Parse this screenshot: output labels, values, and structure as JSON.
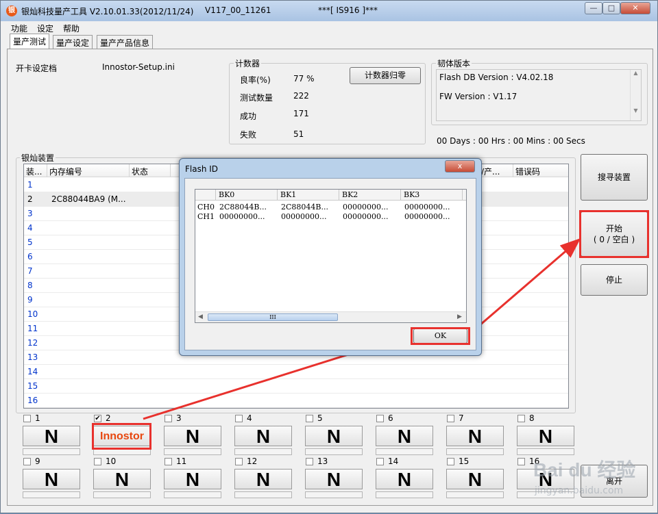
{
  "window": {
    "title": "银灿科技量产工具 V2.10.01.33(2012/11/24)",
    "version": "V117_00_11261",
    "ic": "***[ IS916 ]***",
    "icon": "银"
  },
  "menu": [
    "功能",
    "设定",
    "帮助"
  ],
  "tabs": [
    "量产测试",
    "量产设定",
    "量产产品信息"
  ],
  "config": {
    "label": "开卡设定档",
    "value": "Innostor-Setup.ini"
  },
  "counter": {
    "title": "计数器",
    "reset": "计数器归零",
    "rows": [
      {
        "label": "良率(%)",
        "value": "77 %"
      },
      {
        "label": "测试数量",
        "value": "222"
      },
      {
        "label": "成功",
        "value": "171"
      },
      {
        "label": "失败",
        "value": "51"
      }
    ]
  },
  "firmware": {
    "title": "韧体版本",
    "flash_db": "Flash DB Version :  V4.02.18",
    "fw": "FW Version :    V1.17"
  },
  "timer": "00 Days : 00 Hrs : 00 Mins : 00 Secs",
  "devices": {
    "title": "银灿装置",
    "headers": [
      "装...",
      "内存编号",
      "状态",
      "",
      "",
      "",
      "/产...",
      "错误码"
    ],
    "rows": [
      "1",
      "2",
      "3",
      "4",
      "5",
      "6",
      "7",
      "8",
      "9",
      "10",
      "11",
      "12",
      "13",
      "14",
      "15",
      "16"
    ],
    "row2_id": "2C88044BA9 (M..."
  },
  "side_buttons": {
    "search": "搜寻装置",
    "start_line1": "开始",
    "start_line2": "( 0 / 空白  )",
    "stop": "停止",
    "exit": "离开"
  },
  "slots": [
    {
      "num": "1",
      "checked": false,
      "label": "N"
    },
    {
      "num": "2",
      "checked": true,
      "label": "Innostor"
    },
    {
      "num": "3",
      "checked": false,
      "label": "N"
    },
    {
      "num": "4",
      "checked": false,
      "label": "N"
    },
    {
      "num": "5",
      "checked": false,
      "label": "N"
    },
    {
      "num": "6",
      "checked": false,
      "label": "N"
    },
    {
      "num": "7",
      "checked": false,
      "label": "N"
    },
    {
      "num": "8",
      "checked": false,
      "label": "N"
    },
    {
      "num": "9",
      "checked": false,
      "label": "N"
    },
    {
      "num": "10",
      "checked": false,
      "label": "N"
    },
    {
      "num": "11",
      "checked": false,
      "label": "N"
    },
    {
      "num": "12",
      "checked": false,
      "label": "N"
    },
    {
      "num": "13",
      "checked": false,
      "label": "N"
    },
    {
      "num": "14",
      "checked": false,
      "label": "N"
    },
    {
      "num": "15",
      "checked": false,
      "label": "N"
    },
    {
      "num": "16",
      "checked": false,
      "label": "N"
    }
  ],
  "dialog": {
    "title": "Flash ID",
    "columns": [
      "BK0",
      "BK1",
      "BK2",
      "BK3"
    ],
    "rows": [
      {
        "ch": "CH0",
        "cells": [
          "2C88044B...",
          "2C88044B...",
          "00000000...",
          "00000000..."
        ]
      },
      {
        "ch": "CH1",
        "cells": [
          "00000000...",
          "00000000...",
          "00000000...",
          "00000000..."
        ]
      }
    ],
    "ok": "OK",
    "close": "x",
    "scroll_grip": "III"
  },
  "colors": {
    "accent_red": "#e8312d",
    "link_blue": "#0033cc",
    "innostor": "#e8470f"
  },
  "watermark": {
    "brand": "Bai du 经验",
    "url": "jingyan.baidu.com"
  }
}
